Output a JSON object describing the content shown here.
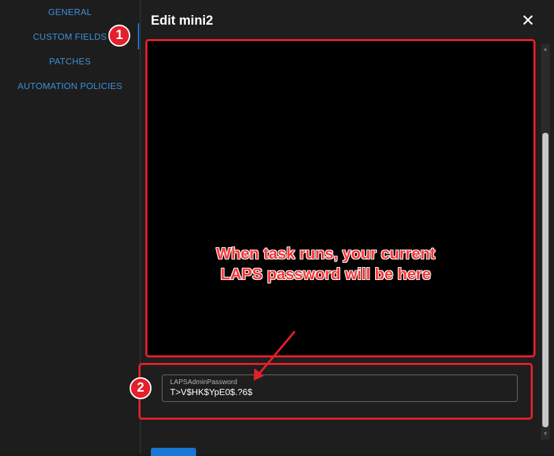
{
  "sidebar": {
    "items": [
      {
        "label": "GENERAL"
      },
      {
        "label": "CUSTOM FIELDS"
      },
      {
        "label": "PATCHES"
      },
      {
        "label": "AUTOMATION POLICIES"
      }
    ],
    "active": "CUSTOM FIELDS"
  },
  "dialog": {
    "title": "Edit mini2",
    "close_icon": "close-icon"
  },
  "annotation": {
    "line1": "When task runs, your current",
    "line2": "LAPS password will be here",
    "badge1": "1",
    "badge2": "2"
  },
  "field": {
    "label": "LAPSAdminPassword",
    "value": "T>V$HK$YpE0$.?6$"
  },
  "colors": {
    "accent": "#1976d2",
    "annotation_red": "#e5202b",
    "nav_text": "#3d8fd6"
  }
}
